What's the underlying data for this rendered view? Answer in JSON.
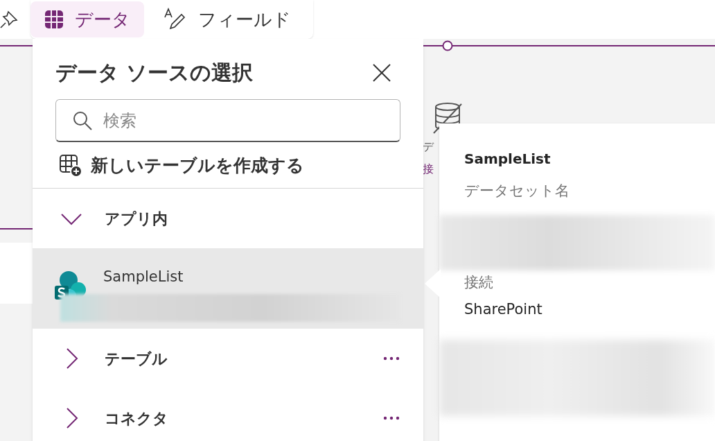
{
  "toolbar": {
    "tabs": [
      {
        "label": "データ",
        "selected": true,
        "kind": "grid"
      },
      {
        "label": "フィールド",
        "selected": false,
        "kind": "pen"
      }
    ]
  },
  "canvas": {
    "hint_fragments": [
      "デ",
      "接"
    ]
  },
  "panel": {
    "title": "データ ソースの選択",
    "search": {
      "placeholder": "検索"
    },
    "create_action": "新しいテーブルを作成する",
    "groups": [
      {
        "label": "アプリ内",
        "expanded": true,
        "has_menu": false,
        "items": [
          {
            "name": "SampleList",
            "selected": true
          }
        ]
      },
      {
        "label": "テーブル",
        "expanded": false,
        "has_menu": true
      },
      {
        "label": "コネクタ",
        "expanded": false,
        "has_menu": true
      }
    ]
  },
  "details_card": {
    "title": "SampleList",
    "fields": [
      {
        "label": "データセット名"
      },
      {
        "label": "接続",
        "value": "SharePoint"
      }
    ]
  }
}
